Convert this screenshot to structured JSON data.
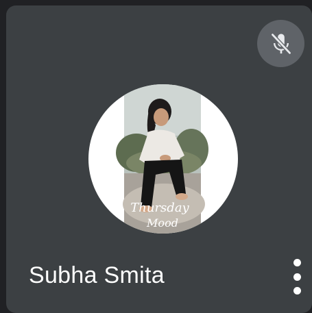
{
  "participant": {
    "name": "Subha Smita",
    "muted": true
  },
  "avatar": {
    "photo_overlay_line1": "Thursday",
    "photo_overlay_line2": "Mood"
  },
  "icons": {
    "mute_indicator": "mic-off-icon",
    "more_options": "more-vert-icon"
  },
  "colors": {
    "background": "#202124",
    "tile": "#3c4043",
    "mute_badge": "#5f6368",
    "text": "#ffffff"
  }
}
